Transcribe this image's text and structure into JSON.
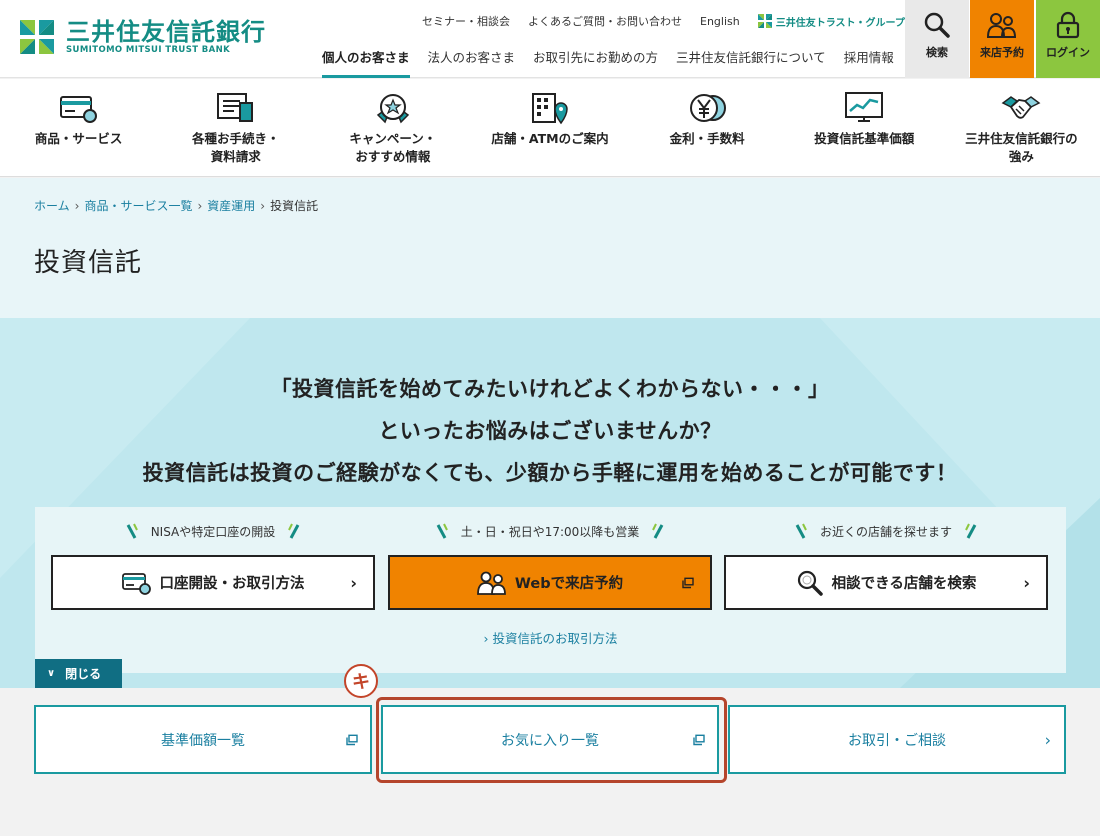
{
  "header": {
    "logo_jp": "三井住友信託銀行",
    "logo_en": "SUMITOMO MITSUI TRUST BANK",
    "util_links": [
      "セミナー・相談会",
      "よくあるご質問・お問い合わせ",
      "English"
    ],
    "group_logo": "三井住友トラスト・グループ",
    "main_nav": [
      "個人のお客さま",
      "法人のお客さま",
      "お取引先にお勤めの方",
      "三井住友信託銀行について",
      "採用情報"
    ],
    "active_nav": "個人のお客さま",
    "search_label": "検索",
    "reserve_label": "来店予約",
    "login_label": "ログイン",
    "colors": {
      "brand": "#148c84",
      "orange": "#f08300",
      "green": "#8cc63f"
    }
  },
  "icon_nav": [
    {
      "icon": "card-icon",
      "line1": "商品・サービス",
      "line2": ""
    },
    {
      "icon": "document-icon",
      "line1": "各種お手続き・",
      "line2": "資料請求"
    },
    {
      "icon": "badge-icon",
      "line1": "キャンペーン・",
      "line2": "おすすめ情報"
    },
    {
      "icon": "building-pin-icon",
      "line1": "店舗・ATMのご案内",
      "line2": ""
    },
    {
      "icon": "yen-coin-icon",
      "line1": "金利・手数料",
      "line2": ""
    },
    {
      "icon": "chart-monitor-icon",
      "line1": "投資信託基準価額",
      "line2": ""
    },
    {
      "icon": "handshake-icon",
      "line1": "三井住友信託銀行の",
      "line2": "強み"
    }
  ],
  "breadcrumb": {
    "home": "ホーム",
    "list": "商品・サービス一覧",
    "asset": "資産運用",
    "current": "投資信託"
  },
  "page_title": "投資信託",
  "promo": {
    "line1": "「投資信託を始めてみたいけれどよくわからない・・・」",
    "line2": "といったお悩みはございませんか？",
    "line3": "投資信託は投資のご経験がなくても、少額から手軽に運用を始めることが可能です！",
    "captions": [
      "NISAや特定口座の開設",
      "土・日・祝日や17:00以降も営業",
      "お近くの店舗を探せます"
    ],
    "buttons": [
      "口座開設・お取引方法",
      "Webで来店予約",
      "相談できる店舗を検索"
    ],
    "trade_link": "投資信託のお取引方法",
    "close_label": "閉じる"
  },
  "bottom": {
    "b1": "基準価額一覧",
    "b2": "お気に入り一覧",
    "b3": "お取引・ご相談"
  },
  "marker": "キ"
}
